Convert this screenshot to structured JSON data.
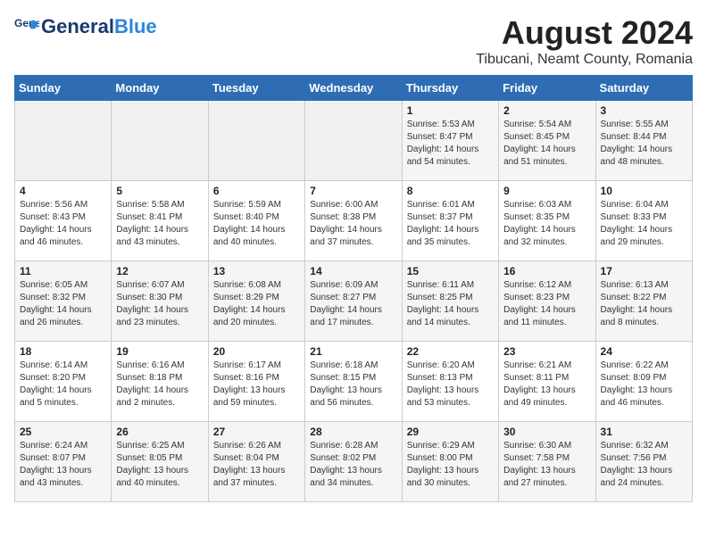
{
  "header": {
    "logo_general": "General",
    "logo_blue": "Blue",
    "main_title": "August 2024",
    "subtitle": "Tibucani, Neamt County, Romania"
  },
  "days_of_week": [
    "Sunday",
    "Monday",
    "Tuesday",
    "Wednesday",
    "Thursday",
    "Friday",
    "Saturday"
  ],
  "weeks": [
    [
      {
        "day": "",
        "info": ""
      },
      {
        "day": "",
        "info": ""
      },
      {
        "day": "",
        "info": ""
      },
      {
        "day": "",
        "info": ""
      },
      {
        "day": "1",
        "info": "Sunrise: 5:53 AM\nSunset: 8:47 PM\nDaylight: 14 hours\nand 54 minutes."
      },
      {
        "day": "2",
        "info": "Sunrise: 5:54 AM\nSunset: 8:45 PM\nDaylight: 14 hours\nand 51 minutes."
      },
      {
        "day": "3",
        "info": "Sunrise: 5:55 AM\nSunset: 8:44 PM\nDaylight: 14 hours\nand 48 minutes."
      }
    ],
    [
      {
        "day": "4",
        "info": "Sunrise: 5:56 AM\nSunset: 8:43 PM\nDaylight: 14 hours\nand 46 minutes."
      },
      {
        "day": "5",
        "info": "Sunrise: 5:58 AM\nSunset: 8:41 PM\nDaylight: 14 hours\nand 43 minutes."
      },
      {
        "day": "6",
        "info": "Sunrise: 5:59 AM\nSunset: 8:40 PM\nDaylight: 14 hours\nand 40 minutes."
      },
      {
        "day": "7",
        "info": "Sunrise: 6:00 AM\nSunset: 8:38 PM\nDaylight: 14 hours\nand 37 minutes."
      },
      {
        "day": "8",
        "info": "Sunrise: 6:01 AM\nSunset: 8:37 PM\nDaylight: 14 hours\nand 35 minutes."
      },
      {
        "day": "9",
        "info": "Sunrise: 6:03 AM\nSunset: 8:35 PM\nDaylight: 14 hours\nand 32 minutes."
      },
      {
        "day": "10",
        "info": "Sunrise: 6:04 AM\nSunset: 8:33 PM\nDaylight: 14 hours\nand 29 minutes."
      }
    ],
    [
      {
        "day": "11",
        "info": "Sunrise: 6:05 AM\nSunset: 8:32 PM\nDaylight: 14 hours\nand 26 minutes."
      },
      {
        "day": "12",
        "info": "Sunrise: 6:07 AM\nSunset: 8:30 PM\nDaylight: 14 hours\nand 23 minutes."
      },
      {
        "day": "13",
        "info": "Sunrise: 6:08 AM\nSunset: 8:29 PM\nDaylight: 14 hours\nand 20 minutes."
      },
      {
        "day": "14",
        "info": "Sunrise: 6:09 AM\nSunset: 8:27 PM\nDaylight: 14 hours\nand 17 minutes."
      },
      {
        "day": "15",
        "info": "Sunrise: 6:11 AM\nSunset: 8:25 PM\nDaylight: 14 hours\nand 14 minutes."
      },
      {
        "day": "16",
        "info": "Sunrise: 6:12 AM\nSunset: 8:23 PM\nDaylight: 14 hours\nand 11 minutes."
      },
      {
        "day": "17",
        "info": "Sunrise: 6:13 AM\nSunset: 8:22 PM\nDaylight: 14 hours\nand 8 minutes."
      }
    ],
    [
      {
        "day": "18",
        "info": "Sunrise: 6:14 AM\nSunset: 8:20 PM\nDaylight: 14 hours\nand 5 minutes."
      },
      {
        "day": "19",
        "info": "Sunrise: 6:16 AM\nSunset: 8:18 PM\nDaylight: 14 hours\nand 2 minutes."
      },
      {
        "day": "20",
        "info": "Sunrise: 6:17 AM\nSunset: 8:16 PM\nDaylight: 13 hours\nand 59 minutes."
      },
      {
        "day": "21",
        "info": "Sunrise: 6:18 AM\nSunset: 8:15 PM\nDaylight: 13 hours\nand 56 minutes."
      },
      {
        "day": "22",
        "info": "Sunrise: 6:20 AM\nSunset: 8:13 PM\nDaylight: 13 hours\nand 53 minutes."
      },
      {
        "day": "23",
        "info": "Sunrise: 6:21 AM\nSunset: 8:11 PM\nDaylight: 13 hours\nand 49 minutes."
      },
      {
        "day": "24",
        "info": "Sunrise: 6:22 AM\nSunset: 8:09 PM\nDaylight: 13 hours\nand 46 minutes."
      }
    ],
    [
      {
        "day": "25",
        "info": "Sunrise: 6:24 AM\nSunset: 8:07 PM\nDaylight: 13 hours\nand 43 minutes."
      },
      {
        "day": "26",
        "info": "Sunrise: 6:25 AM\nSunset: 8:05 PM\nDaylight: 13 hours\nand 40 minutes."
      },
      {
        "day": "27",
        "info": "Sunrise: 6:26 AM\nSunset: 8:04 PM\nDaylight: 13 hours\nand 37 minutes."
      },
      {
        "day": "28",
        "info": "Sunrise: 6:28 AM\nSunset: 8:02 PM\nDaylight: 13 hours\nand 34 minutes."
      },
      {
        "day": "29",
        "info": "Sunrise: 6:29 AM\nSunset: 8:00 PM\nDaylight: 13 hours\nand 30 minutes."
      },
      {
        "day": "30",
        "info": "Sunrise: 6:30 AM\nSunset: 7:58 PM\nDaylight: 13 hours\nand 27 minutes."
      },
      {
        "day": "31",
        "info": "Sunrise: 6:32 AM\nSunset: 7:56 PM\nDaylight: 13 hours\nand 24 minutes."
      }
    ]
  ]
}
